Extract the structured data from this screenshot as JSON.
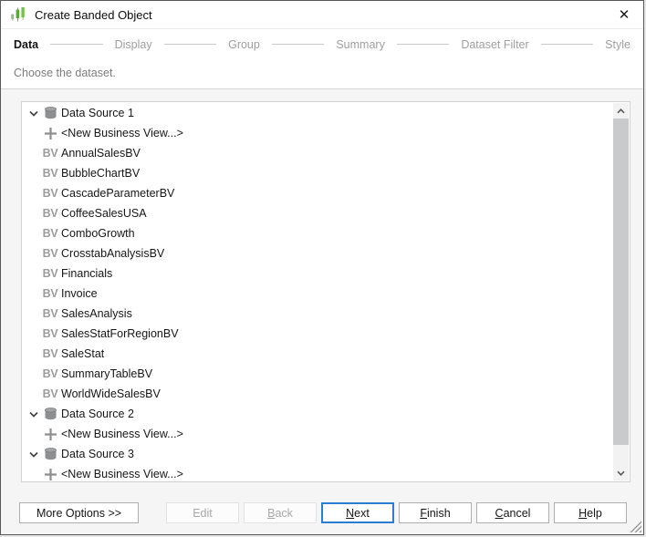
{
  "window": {
    "title": "Create Banded Object",
    "close_glyph": "✕"
  },
  "stepper": {
    "steps": [
      {
        "label": "Data",
        "active": true
      },
      {
        "label": "Display",
        "active": false
      },
      {
        "label": "Group",
        "active": false
      },
      {
        "label": "Summary",
        "active": false
      },
      {
        "label": "Dataset Filter",
        "active": false
      },
      {
        "label": "Style",
        "active": false
      }
    ]
  },
  "prompt": "Choose the dataset.",
  "tree": {
    "bv_icon_text": "BV",
    "nodes": [
      {
        "label": "Data Source 1",
        "expanded": true,
        "children": [
          {
            "type": "new",
            "label": "<New Business View...>"
          },
          {
            "type": "bv",
            "label": "AnnualSalesBV"
          },
          {
            "type": "bv",
            "label": "BubbleChartBV"
          },
          {
            "type": "bv",
            "label": "CascadeParameterBV"
          },
          {
            "type": "bv",
            "label": "CoffeeSalesUSA"
          },
          {
            "type": "bv",
            "label": "ComboGrowth"
          },
          {
            "type": "bv",
            "label": "CrosstabAnalysisBV"
          },
          {
            "type": "bv",
            "label": "Financials"
          },
          {
            "type": "bv",
            "label": "Invoice"
          },
          {
            "type": "bv",
            "label": "SalesAnalysis"
          },
          {
            "type": "bv",
            "label": "SalesStatForRegionBV"
          },
          {
            "type": "bv",
            "label": "SaleStat"
          },
          {
            "type": "bv",
            "label": "SummaryTableBV"
          },
          {
            "type": "bv",
            "label": "WorldWideSalesBV"
          }
        ]
      },
      {
        "label": "Data Source 2",
        "expanded": true,
        "children": [
          {
            "type": "new",
            "label": "<New Business View...>"
          }
        ]
      },
      {
        "label": "Data Source 3",
        "expanded": true,
        "children": [
          {
            "type": "new",
            "label": "<New Business View...>"
          }
        ]
      }
    ]
  },
  "buttons": {
    "more_options": {
      "label": "More Options >>",
      "mnemonic": "",
      "enabled": true
    },
    "edit": {
      "label": "Edit",
      "mnemonic": "",
      "enabled": false
    },
    "back": {
      "label": "Back",
      "mnemonic": "B",
      "enabled": false
    },
    "next": {
      "label": "Next",
      "mnemonic": "N",
      "enabled": true,
      "default": true
    },
    "finish": {
      "label": "Finish",
      "mnemonic": "F",
      "enabled": true
    },
    "cancel": {
      "label": "Cancel",
      "mnemonic": "C",
      "enabled": true
    },
    "help": {
      "label": "Help",
      "mnemonic": "H",
      "enabled": true
    }
  },
  "colors": {
    "accent_blue": "#2b7cd3",
    "step_active": "#141414",
    "step_inactive": "#9f9f9f",
    "icon_gray": "#8e8e8e",
    "brand_green": "#57aa35"
  }
}
